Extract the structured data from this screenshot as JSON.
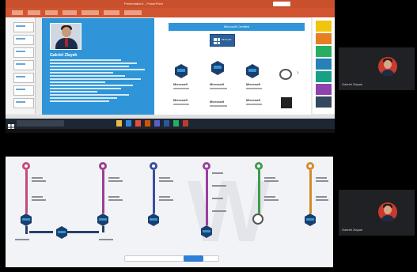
{
  "app": {
    "top_window_title": "Presentation1 - PowerPoint",
    "cert_slide_title": "Microsoft Certified",
    "ms_logo_text": "Microsoft",
    "ms_badge_words": [
      "Microsoft",
      "Microsoft",
      "Microsoft",
      "Microsoft",
      "Microsoft",
      "Microsoft"
    ]
  },
  "slide": {
    "person_name": "Gabriel Zlayah"
  },
  "participants": [
    {
      "name": "Gabriel Zlayah"
    },
    {
      "name": "Gabriel Zlayah"
    }
  ],
  "colors": {
    "ppt_accent": "#c9502d",
    "slide_blue": "#2f95d8",
    "avatar_red": "#c93b2d",
    "timeline": [
      "#c24a7c",
      "#9b3f8c",
      "#3a4f9c",
      "#9b3fa0",
      "#3f9b4a",
      "#d58a2a"
    ]
  },
  "icons": {
    "start": "windows-start-icon",
    "taskbar": [
      "file-explorer-icon",
      "edge-icon",
      "chrome-icon",
      "powerpoint-icon",
      "teams-icon",
      "word-icon"
    ]
  }
}
